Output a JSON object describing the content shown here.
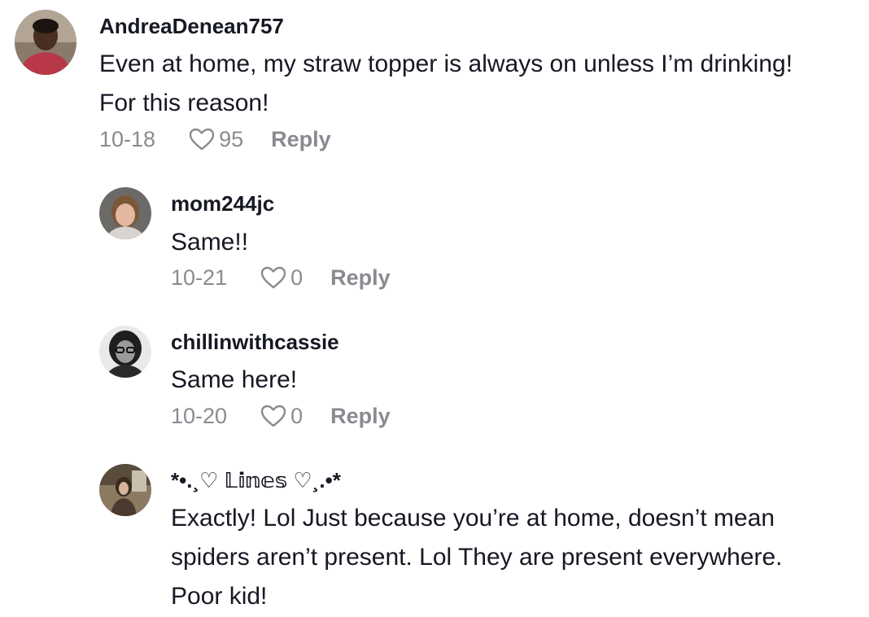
{
  "comments": [
    {
      "username": "AndreaDenean757",
      "text_lines": [
        "Even at home, my straw topper is always on unless I’m drinking!",
        "For this reason!"
      ],
      "date": "10-18",
      "likes": "95",
      "reply_label": "Reply"
    },
    {
      "username": "mom244jc",
      "text_lines": [
        "Same!!"
      ],
      "date": "10-21",
      "likes": "0",
      "reply_label": "Reply"
    },
    {
      "username": "chillinwithcassie",
      "text_lines": [
        "Same here!"
      ],
      "date": "10-20",
      "likes": "0",
      "reply_label": "Reply"
    },
    {
      "username": "*•.¸♡ 𝕃𝕚𝕟𝕖𝕤 ♡¸.•*",
      "text_lines": [
        "Exactly! Lol Just because you’re at home, doesn’t mean",
        "spiders aren’t present. Lol They are present everywhere.",
        "Poor kid!"
      ]
    }
  ],
  "icons": {
    "like": "heart-outline-icon"
  },
  "colors": {
    "text_primary": "#161823",
    "text_secondary": "#8a8b91"
  }
}
